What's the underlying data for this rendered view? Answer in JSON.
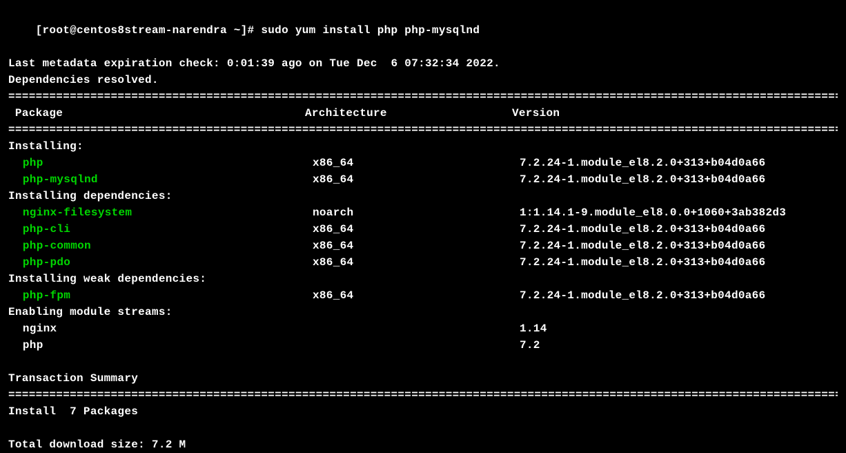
{
  "prompt": "[root@centos8stream-narendra ~]# ",
  "command": "sudo yum install php php-mysqlnd",
  "metadata_line": "Last metadata expiration check: 0:01:39 ago on Tue Dec  6 07:32:34 2022.",
  "deps_resolved": "Dependencies resolved.",
  "divider": "============================================================================================================================================",
  "headers": {
    "package": " Package",
    "arch": "Architecture",
    "version": "Version"
  },
  "sections": {
    "installing": "Installing:",
    "installing_deps": "Installing dependencies:",
    "installing_weak": "Installing weak dependencies:",
    "enabling_streams": "Enabling module streams:"
  },
  "packages": {
    "php": {
      "name": " php",
      "arch": "x86_64",
      "version": "7.2.24-1.module_el8.2.0+313+b04d0a66"
    },
    "php_mysqlnd": {
      "name": " php-mysqlnd",
      "arch": "x86_64",
      "version": "7.2.24-1.module_el8.2.0+313+b04d0a66"
    },
    "nginx_fs": {
      "name": " nginx-filesystem",
      "arch": "noarch",
      "version": "1:1.14.1-9.module_el8.0.0+1060+3ab382d3"
    },
    "php_cli": {
      "name": " php-cli",
      "arch": "x86_64",
      "version": "7.2.24-1.module_el8.2.0+313+b04d0a66"
    },
    "php_common": {
      "name": " php-common",
      "arch": "x86_64",
      "version": "7.2.24-1.module_el8.2.0+313+b04d0a66"
    },
    "php_pdo": {
      "name": " php-pdo",
      "arch": "x86_64",
      "version": "7.2.24-1.module_el8.2.0+313+b04d0a66"
    },
    "php_fpm": {
      "name": " php-fpm",
      "arch": "x86_64",
      "version": "7.2.24-1.module_el8.2.0+313+b04d0a66"
    }
  },
  "streams": {
    "nginx": {
      "name": " nginx",
      "version": "1.14"
    },
    "php": {
      "name": " php",
      "version": "7.2"
    }
  },
  "blank": " ",
  "transaction_summary": "Transaction Summary",
  "install_count": "Install  7 Packages",
  "total_download": "Total download size: 7.2 M"
}
